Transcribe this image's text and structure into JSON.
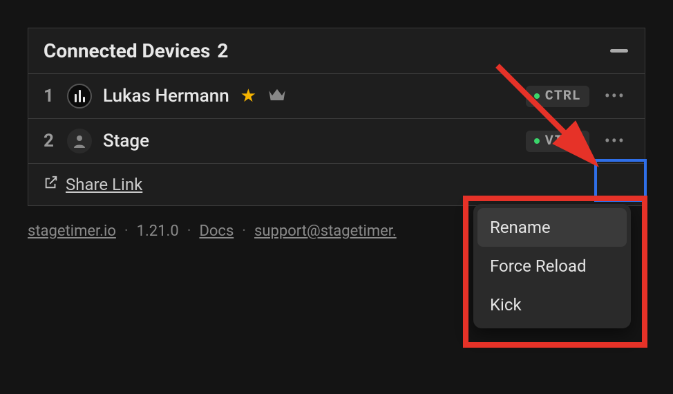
{
  "panel": {
    "title_label": "Connected Devices",
    "count": "2",
    "collapse_tooltip": "Collapse"
  },
  "devices": [
    {
      "index": "1",
      "name": "Lukas Hermann",
      "avatar_icon": "logo-bars",
      "starred": true,
      "owner": true,
      "badge": "CTRL",
      "status": "online"
    },
    {
      "index": "2",
      "name": "Stage",
      "avatar_icon": "person",
      "starred": false,
      "owner": false,
      "badge": "VIEW",
      "status": "online"
    }
  ],
  "share": {
    "label": "Share Link"
  },
  "footer": {
    "site": "stagetimer.io",
    "version": "1.21.0",
    "docs": "Docs",
    "support": "support@stagetimer.",
    "sep": "·"
  },
  "context_menu": {
    "items": [
      "Rename",
      "Force Reload",
      "Kick"
    ],
    "hovered_index": 0
  }
}
